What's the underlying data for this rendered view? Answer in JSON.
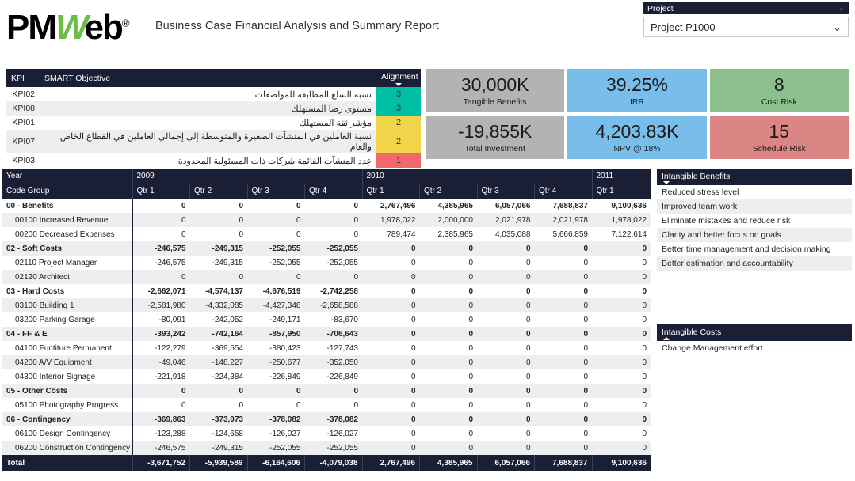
{
  "header": {
    "logo_pm": "PM",
    "logo_w": "W",
    "logo_eb": "eb",
    "logo_reg": "®",
    "report_title": "Business Case Financial Analysis and Summary Report"
  },
  "project_filter": {
    "label": "Project",
    "selected": "Project P1000",
    "chevron": "⌄"
  },
  "kpi_table": {
    "headers": {
      "kpi": "KPI",
      "objective": "SMART Objective",
      "alignment": "Alignment"
    },
    "rows": [
      {
        "kpi": "KPI02",
        "objective": "نسبة السلع المطابقة للمواصفات",
        "alignment": "3",
        "color": "#00bfa5"
      },
      {
        "kpi": "KPI08",
        "objective": "مستوى رضا المستهلك",
        "alignment": "3",
        "color": "#00bfa5"
      },
      {
        "kpi": "KPI01",
        "objective": "مؤشر ثقة المستهلك",
        "alignment": "2",
        "color": "#f2d44a"
      },
      {
        "kpi": "KPI07",
        "objective": "نسبة العاملين في المنشآت الصغيرة والمتوسطة إلى إجمالي العاملين في القطاع الخاص والعام",
        "alignment": "2",
        "color": "#f2d44a"
      },
      {
        "kpi": "KPI03",
        "objective": "عدد المنشآت القائمة شركات ذات المسئولية المحدودة",
        "alignment": "1",
        "color": "#f2676b"
      }
    ]
  },
  "metric_cards": [
    [
      {
        "value": "30,000K",
        "label": "Tangible Benefits",
        "color": "#b3b3b3"
      },
      {
        "value": "39.25%",
        "label": "IRR",
        "color": "#79bdea"
      },
      {
        "value": "8",
        "label": "Cost Risk",
        "color": "#8dc08d"
      }
    ],
    [
      {
        "value": "-19,855K",
        "label": "Total Investment",
        "color": "#b3b3b3"
      },
      {
        "value": "4,203.83K",
        "label": "NPV @ 18%",
        "color": "#79bdea"
      },
      {
        "value": "15",
        "label": "Schedule Risk",
        "color": "#dc8585"
      }
    ]
  ],
  "financial_table": {
    "year_header_label": "Year",
    "code_group_header": "Code Group",
    "years": [
      {
        "label": "2009",
        "span": 4
      },
      {
        "label": "2010",
        "span": 4
      },
      {
        "label": "2011",
        "span": 1
      }
    ],
    "quarters": [
      "Qtr 1",
      "Qtr 2",
      "Qtr 3",
      "Qtr 4",
      "Qtr 1",
      "Qtr 2",
      "Qtr 3",
      "Qtr 4",
      "Qtr 1"
    ],
    "rows": [
      {
        "type": "group",
        "label": "00 - Benefits",
        "values": [
          "0",
          "0",
          "0",
          "0",
          "2,767,496",
          "4,385,965",
          "6,057,066",
          "7,688,837",
          "9,100,636"
        ]
      },
      {
        "type": "child",
        "label": "00100 Increased Revenue",
        "values": [
          "0",
          "0",
          "0",
          "0",
          "1,978,022",
          "2,000,000",
          "2,021,978",
          "2,021,978",
          "1,978,022"
        ]
      },
      {
        "type": "child",
        "label": "00200 Decreased Expenses",
        "values": [
          "0",
          "0",
          "0",
          "0",
          "789,474",
          "2,385,965",
          "4,035,088",
          "5,666,859",
          "7,122,614"
        ]
      },
      {
        "type": "group",
        "label": "02 - Soft Costs",
        "values": [
          "-246,575",
          "-249,315",
          "-252,055",
          "-252,055",
          "0",
          "0",
          "0",
          "0",
          "0"
        ]
      },
      {
        "type": "child",
        "label": "02110 Project Manager",
        "values": [
          "-246,575",
          "-249,315",
          "-252,055",
          "-252,055",
          "0",
          "0",
          "0",
          "0",
          "0"
        ]
      },
      {
        "type": "child",
        "label": "02120 Architect",
        "values": [
          "0",
          "0",
          "0",
          "0",
          "0",
          "0",
          "0",
          "0",
          "0"
        ]
      },
      {
        "type": "group",
        "label": "03 - Hard Costs",
        "values": [
          "-2,662,071",
          "-4,574,137",
          "-4,676,519",
          "-2,742,258",
          "0",
          "0",
          "0",
          "0",
          "0"
        ]
      },
      {
        "type": "child",
        "label": "03100 Building 1",
        "values": [
          "-2,581,980",
          "-4,332,085",
          "-4,427,348",
          "-2,658,588",
          "0",
          "0",
          "0",
          "0",
          "0"
        ]
      },
      {
        "type": "child",
        "label": "03200 Parking Garage",
        "values": [
          "-80,091",
          "-242,052",
          "-249,171",
          "-83,670",
          "0",
          "0",
          "0",
          "0",
          "0"
        ]
      },
      {
        "type": "group",
        "label": "04 - FF & E",
        "values": [
          "-393,242",
          "-742,164",
          "-857,950",
          "-706,643",
          "0",
          "0",
          "0",
          "0",
          "0"
        ]
      },
      {
        "type": "child",
        "label": "04100 Funtiture Permanent",
        "values": [
          "-122,279",
          "-369,554",
          "-380,423",
          "-127,743",
          "0",
          "0",
          "0",
          "0",
          "0"
        ]
      },
      {
        "type": "child",
        "label": "04200 A/V Equipment",
        "values": [
          "-49,046",
          "-148,227",
          "-250,677",
          "-352,050",
          "0",
          "0",
          "0",
          "0",
          "0"
        ]
      },
      {
        "type": "child",
        "label": "04300 Interior Signage",
        "values": [
          "-221,918",
          "-224,384",
          "-226,849",
          "-226,849",
          "0",
          "0",
          "0",
          "0",
          "0"
        ]
      },
      {
        "type": "group",
        "label": "05 - Other Costs",
        "values": [
          "0",
          "0",
          "0",
          "0",
          "0",
          "0",
          "0",
          "0",
          "0"
        ]
      },
      {
        "type": "child",
        "label": "05100 Photography Progress",
        "values": [
          "0",
          "0",
          "0",
          "0",
          "0",
          "0",
          "0",
          "0",
          "0"
        ]
      },
      {
        "type": "group",
        "label": "06 - Contingency",
        "values": [
          "-369,863",
          "-373,973",
          "-378,082",
          "-378,082",
          "0",
          "0",
          "0",
          "0",
          "0"
        ]
      },
      {
        "type": "child",
        "label": "06100 Design Contingency",
        "values": [
          "-123,288",
          "-124,658",
          "-126,027",
          "-126,027",
          "0",
          "0",
          "0",
          "0",
          "0"
        ]
      },
      {
        "type": "child",
        "label": "06200 Construction Contingency",
        "values": [
          "-246,575",
          "-249,315",
          "-252,055",
          "-252,055",
          "0",
          "0",
          "0",
          "0",
          "0"
        ]
      }
    ],
    "total_row": {
      "label": "Total",
      "values": [
        "-3,671,752",
        "-5,939,589",
        "-6,164,606",
        "-4,079,038",
        "2,767,496",
        "4,385,965",
        "6,057,066",
        "7,688,837",
        "9,100,636"
      ]
    }
  },
  "intangible_benefits": {
    "title": "Intangible Benefits",
    "items": [
      "Reduced stress level",
      "Improved team work",
      "Eliminate mistakes and reduce risk",
      "Clarity and better focus on goals",
      "Better time management and decision making",
      "Better estimation and accountability"
    ]
  },
  "intangible_costs": {
    "title": "Intangible Costs",
    "items": [
      "Change Management effort"
    ]
  }
}
